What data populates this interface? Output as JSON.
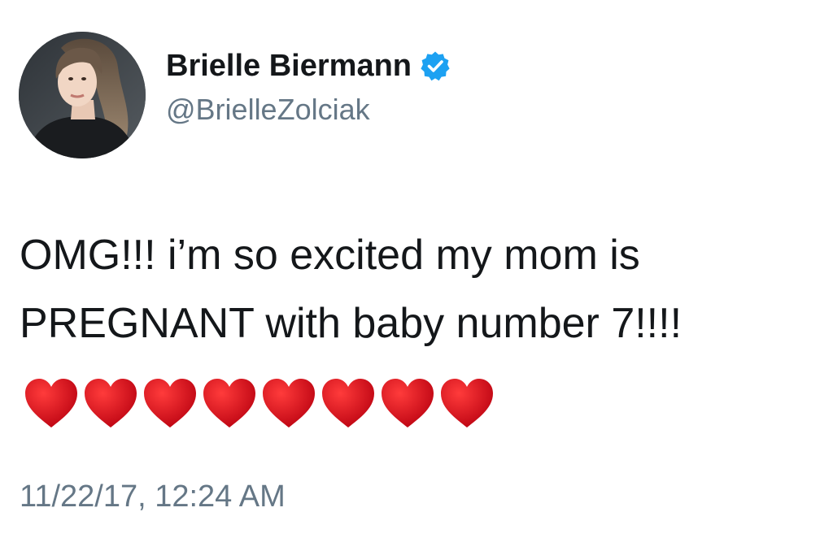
{
  "user": {
    "display_name": "Brielle Biermann",
    "handle": "@BrielleZolciak",
    "verified": true,
    "avatar_icon": "profile-photo",
    "verified_color": "#1da1f2"
  },
  "tweet": {
    "lines": [
      "OMG!!! i’m so excited my mom is",
      "PREGNANT with baby number 7!!!!"
    ],
    "emoji": [
      "❤️",
      "❤️",
      "❤️",
      "❤️",
      "❤️",
      "❤️",
      "❤️",
      "❤️"
    ],
    "emoji_icon": "red-heart-icon",
    "heart_color": "#d0021b"
  },
  "timestamp": "11/22/17, 12:24 AM"
}
